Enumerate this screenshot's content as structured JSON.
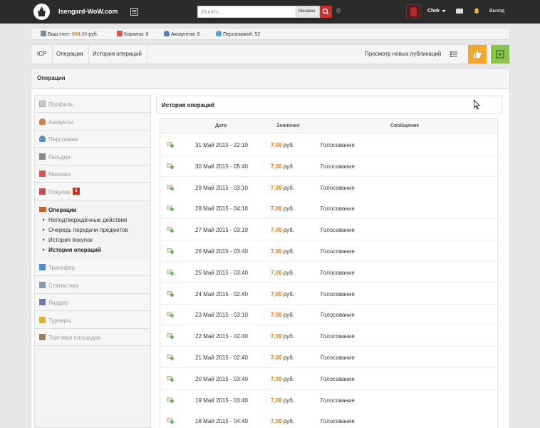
{
  "header": {
    "site_name": "Isengard-WoW.com",
    "search_placeholder": "Искать...",
    "search_scope": "Магазин",
    "username": "Chek",
    "logout_label": "Выход"
  },
  "account": {
    "balance_label": "Ваш счет:",
    "balance_value": "654,00",
    "balance_unit": "руб.",
    "cart_label": "Корзина: 0",
    "accounts_label": "Аккаунтов: 6",
    "characters_label": "Персонажей: 52"
  },
  "breadcrumb": {
    "items": [
      "ICP",
      "Операции",
      "История операций"
    ],
    "new_publications_label": "Просмотр новых публикаций"
  },
  "page_title": "Операции",
  "sidebar": {
    "items_top": [
      {
        "label": "Профиль",
        "icon": "profile-icon"
      },
      {
        "label": "Аккаунты",
        "icon": "accounts-icon"
      },
      {
        "label": "Персонажи",
        "icon": "characters-icon"
      },
      {
        "label": "Гильдии",
        "icon": "guilds-icon"
      },
      {
        "label": "Магазин",
        "icon": "shop-icon"
      },
      {
        "label": "Покупки",
        "icon": "purchases-icon",
        "badge": "1"
      }
    ],
    "submenu_title": "Операции",
    "submenu": [
      "Неподтверждённые действия",
      "Очередь передачи предметов",
      "История покупок",
      "История операций"
    ],
    "items_bottom": [
      {
        "label": "Трансфер",
        "icon": "transfer-icon"
      },
      {
        "label": "Статистика",
        "icon": "statistics-icon"
      },
      {
        "label": "Ладдер",
        "icon": "ladder-icon"
      },
      {
        "label": "Турниры",
        "icon": "tournaments-icon"
      },
      {
        "label": "Торговая площадка",
        "icon": "marketplace-icon"
      }
    ]
  },
  "history": {
    "title": "История операций",
    "columns": [
      "Дата",
      "Значение",
      "Сообщение"
    ],
    "rows": [
      {
        "date": "31 Май 2015 - 22:10",
        "value": "7,00",
        "unit": "руб.",
        "message": "Голосование"
      },
      {
        "date": "30 Май 2015 - 05:40",
        "value": "7,00",
        "unit": "руб.",
        "message": "Голосование"
      },
      {
        "date": "29 Май 2015 - 03:10",
        "value": "7,00",
        "unit": "руб.",
        "message": "Голосование"
      },
      {
        "date": "28 Май 2015 - 04:10",
        "value": "7,00",
        "unit": "руб.",
        "message": "Голосование"
      },
      {
        "date": "27 Май 2015 - 03:10",
        "value": "7,00",
        "unit": "руб.",
        "message": "Голосование"
      },
      {
        "date": "26 Май 2015 - 03:40",
        "value": "7,00",
        "unit": "руб.",
        "message": "Голосование"
      },
      {
        "date": "25 Май 2015 - 03:40",
        "value": "7,00",
        "unit": "руб.",
        "message": "Голосование"
      },
      {
        "date": "24 Май 2015 - 02:40",
        "value": "7,00",
        "unit": "руб.",
        "message": "Голосование"
      },
      {
        "date": "23 Май 2015 - 03:10",
        "value": "7,00",
        "unit": "руб.",
        "message": "Голосование"
      },
      {
        "date": "22 Май 2015 - 02:40",
        "value": "7,00",
        "unit": "руб.",
        "message": "Голосование"
      },
      {
        "date": "21 Май 2015 - 02:40",
        "value": "7,00",
        "unit": "руб.",
        "message": "Голосование"
      },
      {
        "date": "20 Май 2015 - 03:40",
        "value": "7,00",
        "unit": "руб.",
        "message": "Голосование"
      },
      {
        "date": "19 Май 2015 - 03:40",
        "value": "7,00",
        "unit": "руб.",
        "message": "Голосование"
      },
      {
        "date": "18 Май 2015 - 04:40",
        "value": "7,00",
        "unit": "руб.",
        "message": "Голосование"
      }
    ]
  },
  "colors": {
    "accent_orange": "#e07b10",
    "danger": "#c9302c",
    "success": "#8cc34a"
  }
}
